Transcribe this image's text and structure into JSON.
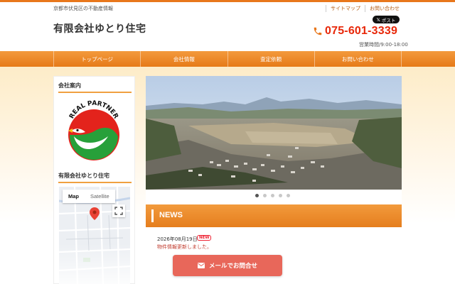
{
  "header": {
    "tagline": "京都市伏見区の不動産情報",
    "links": [
      "サイトマップ",
      "お問い合わせ"
    ],
    "logo": "有限会社ゆとり住宅",
    "x_post": "ポスト",
    "x_glyph": "𝕏",
    "phone": "075-601-3339",
    "hours": "営業時間/9:00-18:00"
  },
  "nav": {
    "items": [
      "トップページ",
      "会社情報",
      "査定依頼",
      "お問い合わせ"
    ]
  },
  "sidebar": {
    "company_heading": "会社案内",
    "logo_text": "REAL PARTNER",
    "company_name": "有限会社ゆとり住宅",
    "map": {
      "tab_map": "Map",
      "tab_satellite": "Satellite"
    }
  },
  "slider": {
    "slide_count": 5,
    "active_index": 0
  },
  "news": {
    "title": "NEWS",
    "date": "2026年08月19日",
    "badge": "NEW",
    "text": "物件情報更新しました。"
  },
  "cta": {
    "label": "メールでお問合せ"
  },
  "colors": {
    "accent": "#e8771c",
    "phone": "#e8280a",
    "cta": "#e8675a"
  }
}
